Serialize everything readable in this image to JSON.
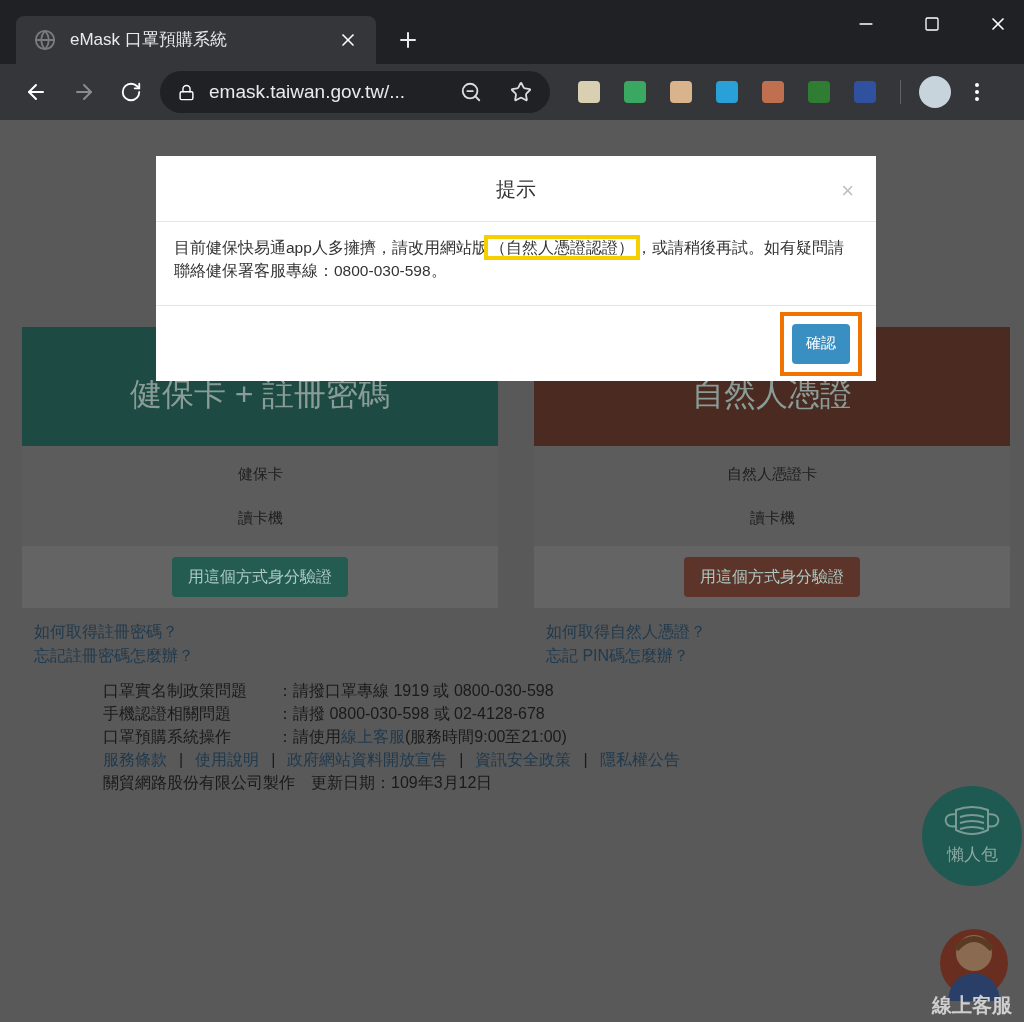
{
  "browser": {
    "tab_title": "eMask 口罩預購系統",
    "url": "emask.taiwan.gov.tw/..."
  },
  "cards": [
    {
      "title": "健保卡 + 註冊密碼",
      "color": "#1d4a42",
      "items": [
        "健保卡",
        "讀卡機"
      ],
      "button": "用這個方式身分驗證",
      "links": [
        "如何取得註冊密碼？",
        "忘記註冊密碼怎麼辦？"
      ]
    },
    {
      "title": "自然人憑證",
      "color": "#4a2a21",
      "items": [
        "自然人憑證卡",
        "讀卡機"
      ],
      "button": "用這個方式身分驗證",
      "links": [
        "如何取得自然人憑證？",
        "忘記 PIN碼怎麼辦？"
      ]
    }
  ],
  "info_rows": [
    {
      "label": "口罩實名制政策問題",
      "value": "：請撥口罩專線 1919 或 0800-030-598"
    },
    {
      "label": "手機認證相關問題",
      "value": "：請撥 0800-030-598 或 02-4128-678"
    },
    {
      "label": "口罩預購系統操作",
      "value": "：請使用",
      "link": "線上客服",
      "suffix": "(服務時間9:00至21:00)"
    }
  ],
  "footer_links": [
    "服務條款",
    "使用說明",
    "政府網站資料開放宣告",
    "資訊安全政策",
    "隱私權公告"
  ],
  "footer_separator": "|",
  "credit": "關貿網路股份有限公司製作",
  "updated": "更新日期：109年3月12日",
  "floating": {
    "guide": "懶人包",
    "support": "線上客服"
  },
  "modal": {
    "title": "提示",
    "close": "×",
    "message_before": "目前健保快易通app人多擁擠，請改用網站版",
    "message_highlight": "（自然人憑證認證）",
    "message_after": "，或請稍後再試。如有疑問請聯絡健保署客服專線：0800-030-598。",
    "confirm": "確認"
  }
}
